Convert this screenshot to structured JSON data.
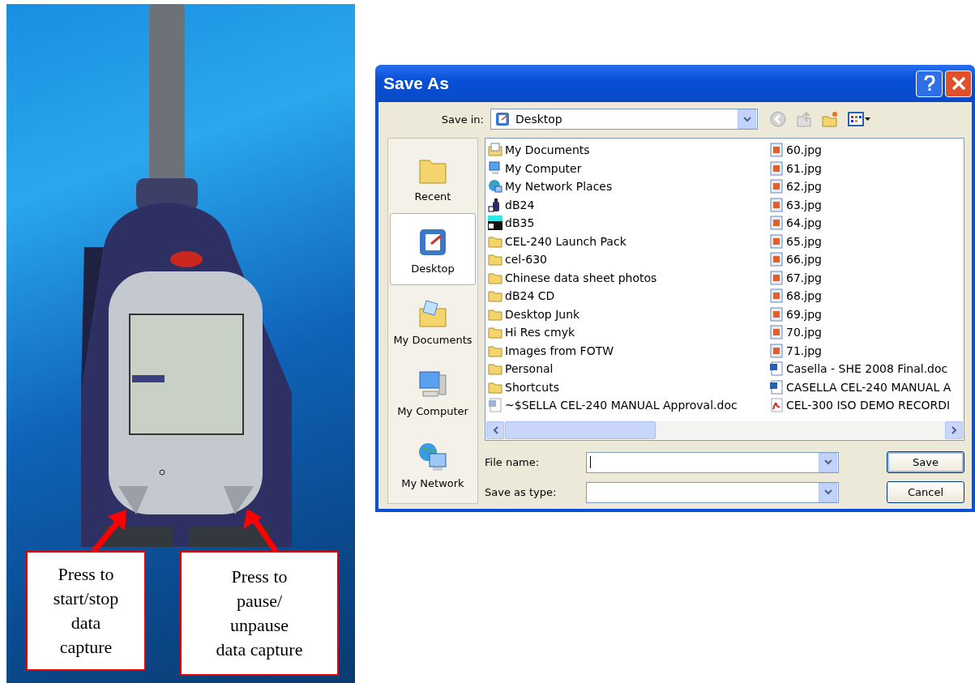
{
  "callouts": [
    {
      "text": "Press to\nstart/stop\ndata\ncapture"
    },
    {
      "text": "Press to\npause/\nunpause\ndata capture"
    }
  ],
  "dialog": {
    "title": "Save As",
    "save_in": {
      "label": "Save in:",
      "value": "Desktop"
    },
    "places": [
      {
        "label": "Recent",
        "kind": "recent",
        "selected": false
      },
      {
        "label": "Desktop",
        "kind": "desktop",
        "selected": true
      },
      {
        "label": "My Documents",
        "kind": "documents",
        "selected": false
      },
      {
        "label": "My Computer",
        "kind": "computer",
        "selected": false
      },
      {
        "label": "My Network",
        "kind": "network",
        "selected": false
      }
    ],
    "files": [
      {
        "name": "My Documents",
        "kind": "mydocs"
      },
      {
        "name": "My Computer",
        "kind": "computer"
      },
      {
        "name": "My Network Places",
        "kind": "network"
      },
      {
        "name": "dB24",
        "kind": "device"
      },
      {
        "name": "dB35",
        "kind": "app"
      },
      {
        "name": "CEL-240 Launch Pack",
        "kind": "folder"
      },
      {
        "name": "cel-630",
        "kind": "folder"
      },
      {
        "name": "Chinese data sheet photos",
        "kind": "folder"
      },
      {
        "name": "dB24 CD",
        "kind": "folder"
      },
      {
        "name": "Desktop Junk",
        "kind": "folder"
      },
      {
        "name": "Hi Res cmyk",
        "kind": "folder"
      },
      {
        "name": "Images from FOTW",
        "kind": "folder"
      },
      {
        "name": "Personal",
        "kind": "folder"
      },
      {
        "name": "Shortcuts",
        "kind": "folder"
      },
      {
        "name": "~$SELLA CEL-240 MANUAL Approval.doc",
        "kind": "tempdoc"
      },
      {
        "name": "60.jpg",
        "kind": "jpg"
      },
      {
        "name": "61.jpg",
        "kind": "jpg"
      },
      {
        "name": "62.jpg",
        "kind": "jpg"
      },
      {
        "name": "63.jpg",
        "kind": "jpg"
      },
      {
        "name": "64.jpg",
        "kind": "jpg"
      },
      {
        "name": "65.jpg",
        "kind": "jpg"
      },
      {
        "name": "66.jpg",
        "kind": "jpg"
      },
      {
        "name": "67.jpg",
        "kind": "jpg"
      },
      {
        "name": "68.jpg",
        "kind": "jpg"
      },
      {
        "name": "69.jpg",
        "kind": "jpg"
      },
      {
        "name": "70.jpg",
        "kind": "jpg"
      },
      {
        "name": "71.jpg",
        "kind": "jpg"
      },
      {
        "name": "Casella - SHE 2008 Final.doc",
        "kind": "doc"
      },
      {
        "name": "CASELLA CEL-240 MANUAL A",
        "kind": "doc"
      },
      {
        "name": "CEL-300 ISO DEMO RECORDI",
        "kind": "pdf"
      }
    ],
    "file_name": {
      "label": "File name:"
    },
    "save_as_type": {
      "label": "Save as type:"
    },
    "buttons": [
      "Save",
      "Cancel"
    ]
  }
}
